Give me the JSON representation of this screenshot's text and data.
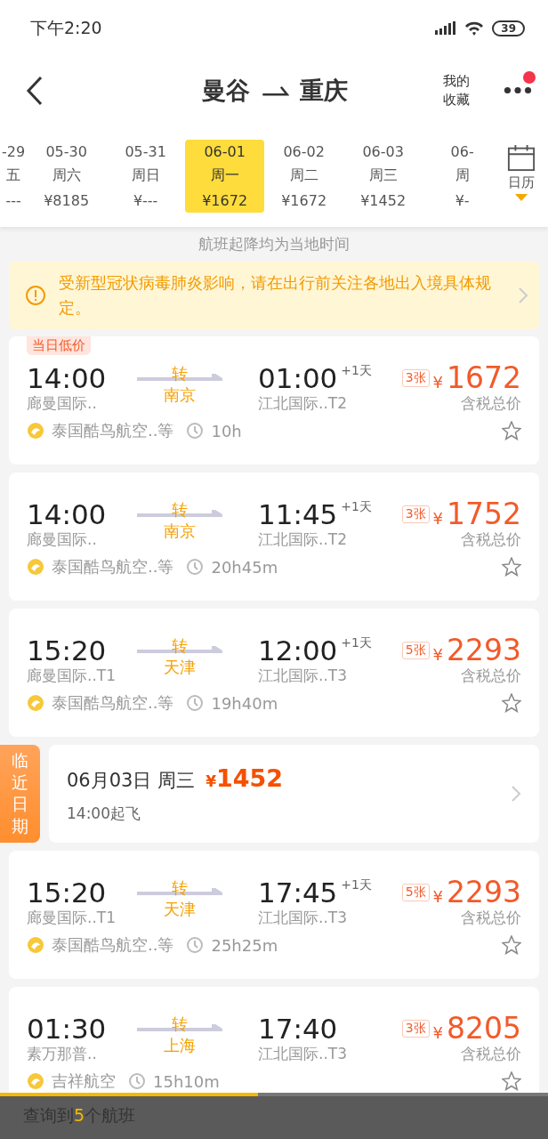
{
  "status_bar": {
    "time": "下午2:20",
    "battery": "39"
  },
  "header": {
    "from": "曼谷",
    "to": "重庆",
    "favorites_label": [
      "我的",
      "收藏"
    ],
    "has_notification": true
  },
  "dates": [
    {
      "date": "-29",
      "weekday": "五",
      "price": "---",
      "selected": false
    },
    {
      "date": "05-30",
      "weekday": "周六",
      "price": "¥8185",
      "selected": false
    },
    {
      "date": "05-31",
      "weekday": "周日",
      "price": "¥---",
      "selected": false
    },
    {
      "date": "06-01",
      "weekday": "周一",
      "price": "¥1672",
      "selected": true
    },
    {
      "date": "06-02",
      "weekday": "周二",
      "price": "¥1672",
      "selected": false
    },
    {
      "date": "06-03",
      "weekday": "周三",
      "price": "¥1452",
      "selected": false
    },
    {
      "date": "06-",
      "weekday": "周",
      "price": "¥-",
      "selected": false
    }
  ],
  "calendar_label": "日历",
  "time_note": "航班起降均为当地时间",
  "notice": "受新型冠状病毒肺炎影响，请在出行前关注各地出入境具体规定。",
  "results": [
    {
      "kind": "flight",
      "tag": "当日低价",
      "dep_time": "14:00",
      "dep_airport": "廊曼国际..",
      "transfer": "转",
      "via": "南京",
      "arr_time": "01:00",
      "arr_day": "+1天",
      "arr_airport": "江北国际..T2",
      "tickets": "3张",
      "currency": "¥",
      "price": "1672",
      "price_note": "含税总价",
      "airline": "泰国酷鸟航空..等",
      "duration": "10h",
      "favorite": false
    },
    {
      "kind": "flight",
      "dep_time": "14:00",
      "dep_airport": "廊曼国际..",
      "transfer": "转",
      "via": "南京",
      "arr_time": "11:45",
      "arr_day": "+1天",
      "arr_airport": "江北国际..T2",
      "tickets": "3张",
      "currency": "¥",
      "price": "1752",
      "price_note": "含税总价",
      "airline": "泰国酷鸟航空..等",
      "duration": "20h45m",
      "favorite": false
    },
    {
      "kind": "flight",
      "dep_time": "15:20",
      "dep_airport": "廊曼国际..T1",
      "transfer": "转",
      "via": "天津",
      "arr_time": "12:00",
      "arr_day": "+1天",
      "arr_airport": "江北国际..T3",
      "tickets": "5张",
      "currency": "¥",
      "price": "2293",
      "price_note": "含税总价",
      "airline": "泰国酷鸟航空..等",
      "duration": "19h40m",
      "favorite": false
    },
    {
      "kind": "nearby",
      "label": "临近日期",
      "date": "06月03日 周三",
      "currency": "¥",
      "price": "1452",
      "departure": "14:00起飞"
    },
    {
      "kind": "flight",
      "dep_time": "15:20",
      "dep_airport": "廊曼国际..T1",
      "transfer": "转",
      "via": "天津",
      "arr_time": "17:45",
      "arr_day": "+1天",
      "arr_airport": "江北国际..T3",
      "tickets": "5张",
      "currency": "¥",
      "price": "2293",
      "price_note": "含税总价",
      "airline": "泰国酷鸟航空..等",
      "duration": "25h25m",
      "favorite": false
    },
    {
      "kind": "flight",
      "dep_time": "01:30",
      "dep_airport": "素万那普..",
      "transfer": "转",
      "via": "上海",
      "arr_time": "17:40",
      "arr_airport": "江北国际..T3",
      "tickets": "3张",
      "currency": "¥",
      "price": "8205",
      "price_note": "含税总价",
      "airline": "吉祥航空",
      "duration": "15h10m",
      "favorite": false
    }
  ],
  "footer": {
    "progress": {
      "level": 0.47
    },
    "text_before": "查询到",
    "count": "5",
    "text_after": "个航班"
  }
}
